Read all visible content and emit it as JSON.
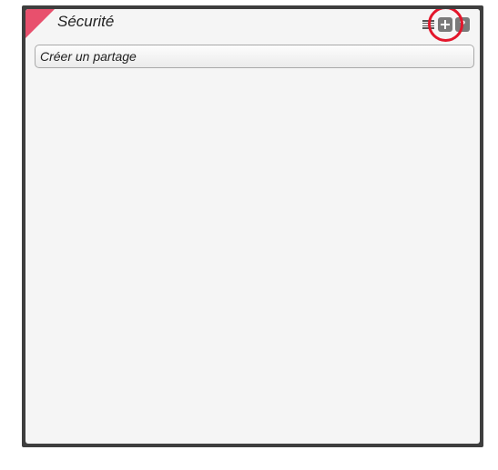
{
  "panel": {
    "title": "Sécurité",
    "accent_color": "#e8506d",
    "highlight_color": "#e3162b"
  },
  "toolbar": {
    "icons": [
      "list-icon",
      "plus-icon",
      "help-icon"
    ],
    "help_glyph": "?"
  },
  "list": {
    "items": [
      {
        "label": "Créer un partage"
      }
    ]
  }
}
